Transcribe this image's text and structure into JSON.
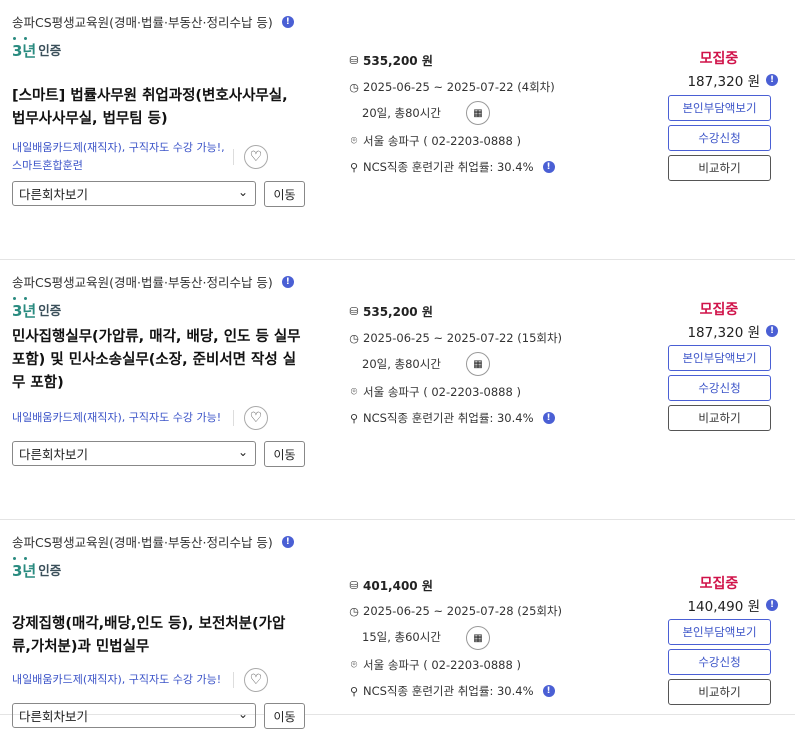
{
  "colors": {
    "accent": "#3c54c8",
    "status": "#d0134a",
    "cert": "#2a8b80"
  },
  "icons": {
    "info": "info-icon",
    "heart": "heart-icon",
    "calendar": "calendar-icon",
    "chevron": "chevron-down-icon",
    "coin": "coin-icon",
    "clock": "clock-icon",
    "pin": "location-pin-icon",
    "person": "person-icon"
  },
  "courses": [
    {
      "institution": "송파CS평생교육원(경매·법률·부동산·정리수납 등)",
      "cert_num": "3년",
      "cert_label": "인증",
      "title": "[스마트] 법률사무원 취업과정(변호사사무실, 법무사사무실, 법무팀 등)",
      "tags": "내일배움카드제(재직자), 구직자도 수강 가능!, 스마트혼합훈련",
      "select_label": "다른회차보기",
      "move_label": "이동",
      "price": "535,200 원",
      "period": "2025-06-25 ~ 2025-07-22 (4회차)",
      "duration": "20일, 총80시간",
      "location": "서울 송파구 ( 02-2203-0888 )",
      "employment": "NCS직종 훈련기관 취업률: 30.4%",
      "status": "모집중",
      "self_pay": "187,320 원",
      "btn_self": "본인부담액보기",
      "btn_apply": "수강신청",
      "btn_compare": "비교하기"
    },
    {
      "institution": "송파CS평생교육원(경매·법률·부동산·정리수납 등)",
      "cert_num": "3년",
      "cert_label": "인증",
      "title": "민사집행실무(가압류, 매각, 배당, 인도 등 실무 포함) 및 민사소송실무(소장, 준비서면 작성 실무 포함)",
      "tags": "내일배움카드제(재직자), 구직자도 수강 가능!",
      "select_label": "다른회차보기",
      "move_label": "이동",
      "price": "535,200 원",
      "period": "2025-06-25 ~ 2025-07-22 (15회차)",
      "duration": "20일, 총80시간",
      "location": "서울 송파구 ( 02-2203-0888 )",
      "employment": "NCS직종 훈련기관 취업률: 30.4%",
      "status": "모집중",
      "self_pay": "187,320 원",
      "btn_self": "본인부담액보기",
      "btn_apply": "수강신청",
      "btn_compare": "비교하기"
    },
    {
      "institution": "송파CS평생교육원(경매·법률·부동산·정리수납 등)",
      "cert_num": "3년",
      "cert_label": "인증",
      "title": "강제집행(매각,배당,인도 등), 보전처분(가압류,가처분)과 민법실무",
      "tags": "내일배움카드제(재직자), 구직자도 수강 가능!",
      "select_label": "다른회차보기",
      "move_label": "이동",
      "price": "401,400 원",
      "period": "2025-06-25 ~ 2025-07-28 (25회차)",
      "duration": "15일, 총60시간",
      "location": "서울 송파구 ( 02-2203-0888 )",
      "employment": "NCS직종 훈련기관 취업률: 30.4%",
      "status": "모집중",
      "self_pay": "140,490 원",
      "btn_self": "본인부담액보기",
      "btn_apply": "수강신청",
      "btn_compare": "비교하기"
    }
  ]
}
